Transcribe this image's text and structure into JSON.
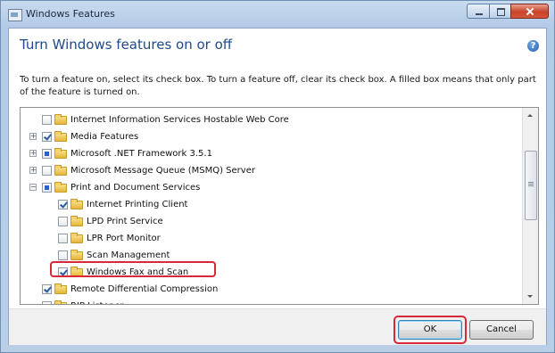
{
  "window": {
    "title": "Windows Features",
    "accent_close": "#c7432a"
  },
  "header": {
    "heading": "Turn Windows features on or off",
    "help_icon": "help-icon"
  },
  "description": "To turn a feature on, select its check box. To turn a feature off, clear its check box. A filled box means that only part of the feature is turned on.",
  "features": [
    {
      "label": "Internet Information Services Hostable Web Core",
      "state": "unchecked",
      "expandable": false,
      "level": 0
    },
    {
      "label": "Media Features",
      "state": "checked",
      "expandable": true,
      "level": 0
    },
    {
      "label": "Microsoft .NET Framework 3.5.1",
      "state": "partial",
      "expandable": true,
      "level": 0
    },
    {
      "label": "Microsoft Message Queue (MSMQ) Server",
      "state": "unchecked",
      "expandable": true,
      "level": 0
    },
    {
      "label": "Print and Document Services",
      "state": "partial",
      "expandable": true,
      "expanded": true,
      "level": 0
    },
    {
      "label": "Internet Printing Client",
      "state": "checked",
      "expandable": false,
      "level": 1
    },
    {
      "label": "LPD Print Service",
      "state": "unchecked",
      "expandable": false,
      "level": 1
    },
    {
      "label": "LPR Port Monitor",
      "state": "unchecked",
      "expandable": false,
      "level": 1
    },
    {
      "label": "Scan Management",
      "state": "unchecked",
      "expandable": false,
      "level": 1
    },
    {
      "label": "Windows Fax and Scan",
      "state": "checked",
      "expandable": false,
      "level": 1,
      "highlighted": true
    },
    {
      "label": "Remote Differential Compression",
      "state": "checked",
      "expandable": false,
      "level": 0
    },
    {
      "label": "RIP Listener",
      "state": "unchecked",
      "expandable": false,
      "level": 0
    }
  ],
  "buttons": {
    "ok": "OK",
    "cancel": "Cancel"
  },
  "highlight_color": "#d8283a"
}
